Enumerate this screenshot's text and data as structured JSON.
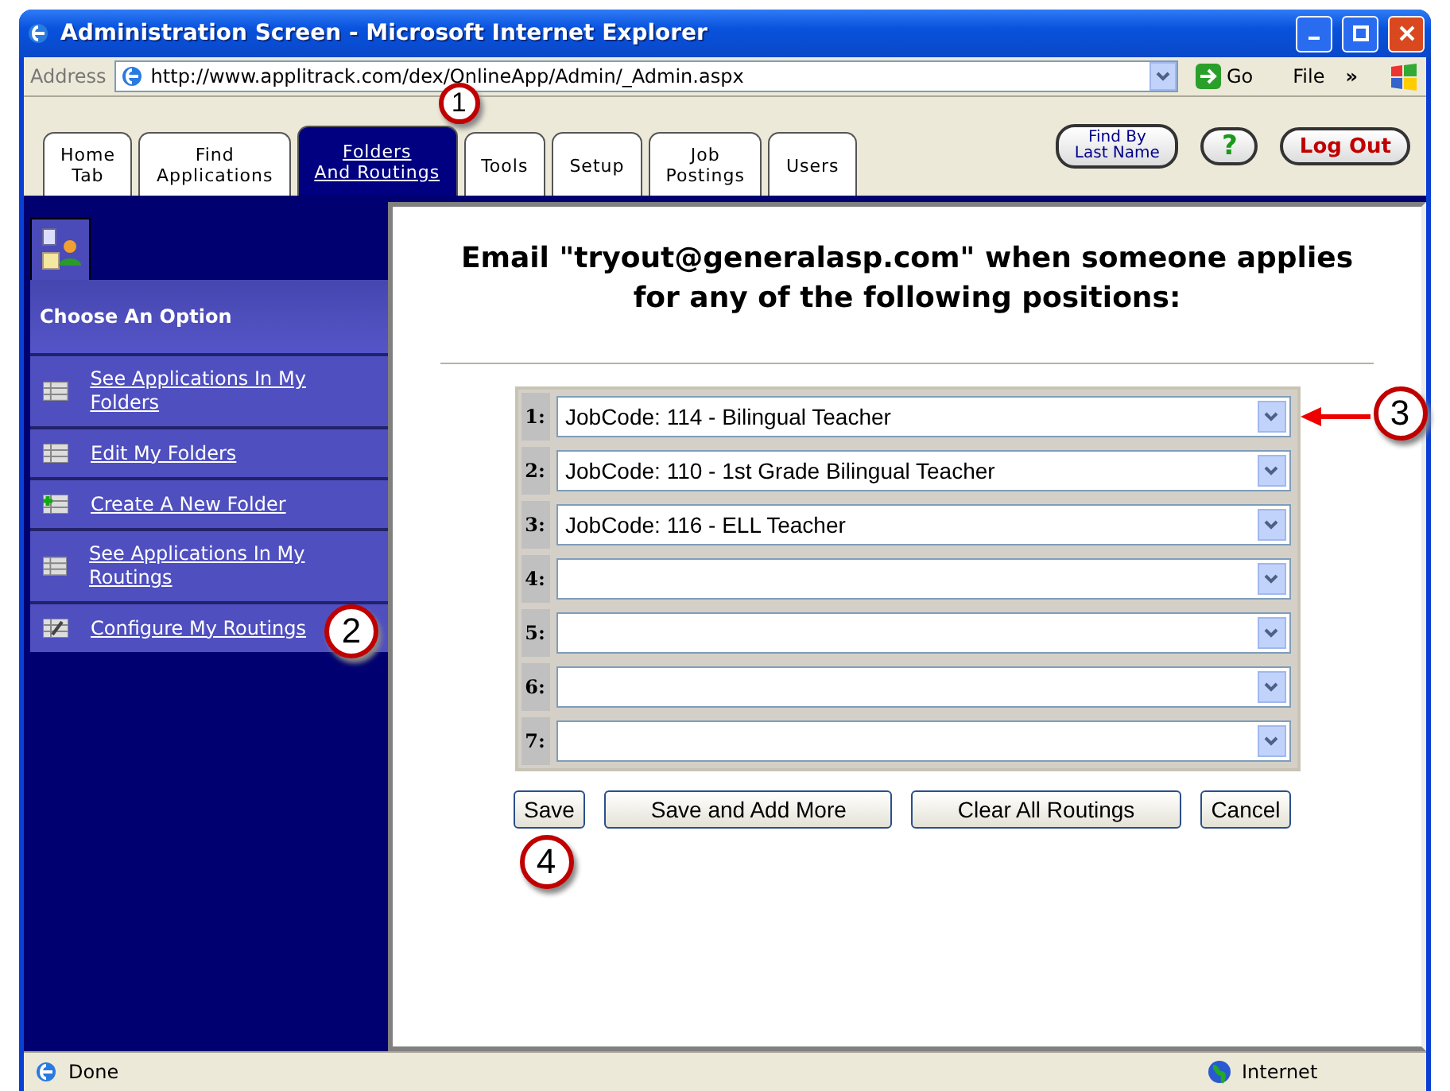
{
  "window": {
    "title": "Administration Screen - Microsoft Internet Explorer"
  },
  "address_bar": {
    "label": "Address",
    "url": "http://www.applitrack.com/dex/OnlineApp/Admin/_Admin.aspx",
    "go": "Go",
    "menu": "File",
    "more": "»"
  },
  "tabs": [
    {
      "label": "Home\nTab",
      "selected": false
    },
    {
      "label": "Find\nApplications",
      "selected": false
    },
    {
      "label": "Folders\nAnd Routings",
      "selected": true,
      "callout": "1"
    },
    {
      "label": "Tools",
      "selected": false
    },
    {
      "label": "Setup",
      "selected": false
    },
    {
      "label": "Job\nPostings",
      "selected": false
    },
    {
      "label": "Users",
      "selected": false
    }
  ],
  "header_buttons": [
    {
      "kind": "pill",
      "label": "Find By\nLast Name"
    },
    {
      "kind": "help",
      "label": "?"
    },
    {
      "kind": "logout",
      "label": "Log Out"
    }
  ],
  "sidebar": {
    "heading": "Choose An Option",
    "items": [
      {
        "label": "See Applications In My Folders"
      },
      {
        "label": "Edit My Folders"
      },
      {
        "label": "Create A New Folder"
      },
      {
        "label": "See Applications In My Routings"
      },
      {
        "label": "Configure My Routings",
        "callout": "2"
      }
    ]
  },
  "content": {
    "heading": "Email \"tryout@generalasp.com\" when someone applies for any of the following positions:",
    "routings": [
      {
        "number": "1:",
        "value": "JobCode: 114 - Bilingual Teacher",
        "callout": "3"
      },
      {
        "number": "2:",
        "value": "JobCode: 110 - 1st Grade Bilingual Teacher"
      },
      {
        "number": "3:",
        "value": "JobCode: 116 - ELL Teacher"
      },
      {
        "number": "4:"
      },
      {
        "number": "5:"
      },
      {
        "number": "6:"
      },
      {
        "number": "7:"
      }
    ],
    "buttons": [
      {
        "label": "Save",
        "callout": "4"
      },
      {
        "label": "Save and Add More"
      },
      {
        "label": "Clear All Routings"
      },
      {
        "label": "Cancel"
      }
    ]
  },
  "status_bar": {
    "text": "Done",
    "zone": "Internet"
  }
}
